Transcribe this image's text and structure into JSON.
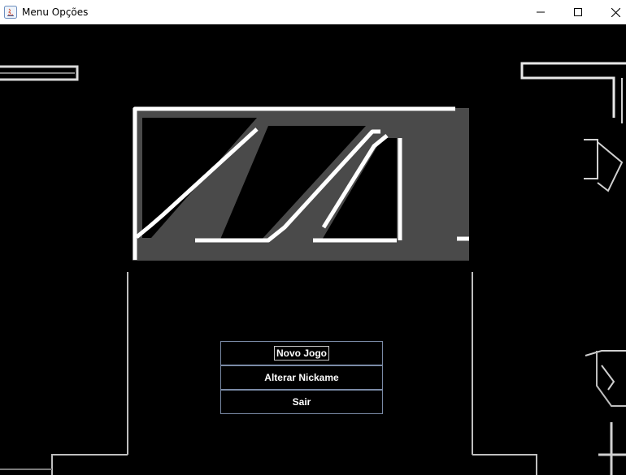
{
  "window": {
    "title": "Menu Opções",
    "controls": [
      "minimize-icon",
      "maximize-icon",
      "close-icon"
    ]
  },
  "background": {
    "logo": "ZA",
    "colors": {
      "background": "#000000",
      "logo_fill": "#4a4a4a",
      "logo_outline": "#ffffff"
    }
  },
  "menu": {
    "items": [
      {
        "label": "Novo Jogo",
        "focused": true
      },
      {
        "label": "Alterar Nickame",
        "focused": false
      },
      {
        "label": "Sair",
        "focused": false
      }
    ],
    "colors": {
      "button_bg": "#000000",
      "button_border": "#7a8aa6",
      "text": "#ffffff"
    }
  }
}
